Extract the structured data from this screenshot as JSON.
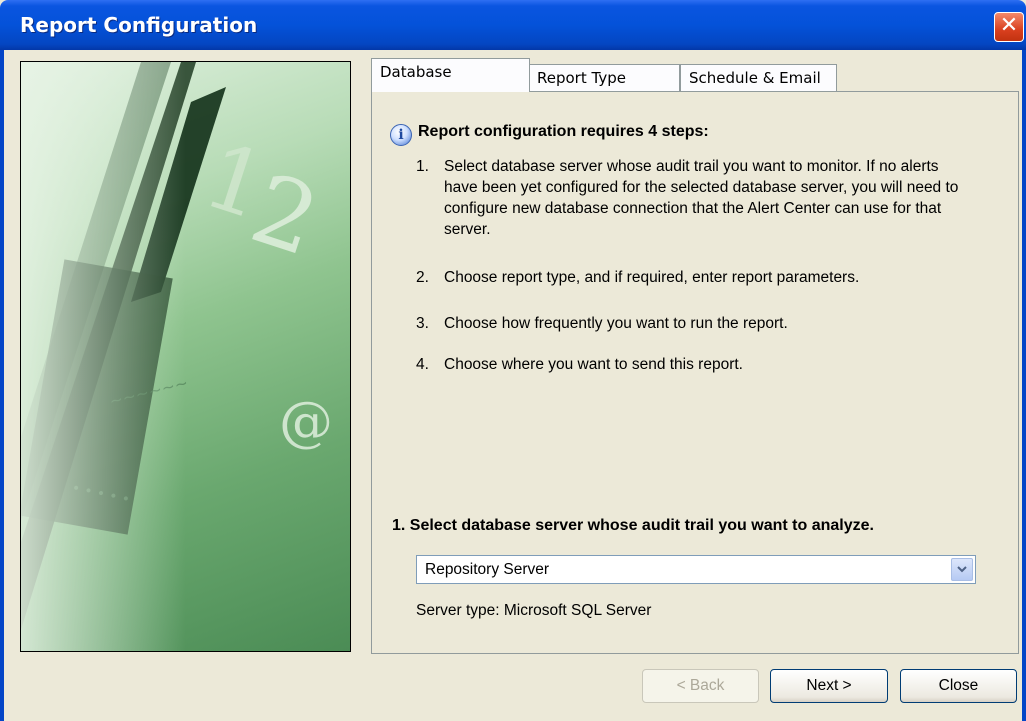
{
  "window": {
    "title": "Report Configuration",
    "close_glyph": "✕"
  },
  "tabs": [
    {
      "label": "Database",
      "active": true
    },
    {
      "label": "Report Type",
      "active": false
    },
    {
      "label": "Schedule & Email",
      "active": false
    }
  ],
  "content": {
    "info_icon_glyph": "i",
    "heading": "Report configuration requires 4 steps:",
    "steps": [
      {
        "num": "1.",
        "text": "Select database server whose audit trail you want to monitor. If no alerts have been yet configured for the selected database server, you will need to configure new database connection that the Alert Center can use for that server."
      },
      {
        "num": "2.",
        "text": "Choose report type, and if required, enter report parameters."
      },
      {
        "num": "3.",
        "text": "Choose how frequently you want to run the report."
      },
      {
        "num": "4.",
        "text": "Choose where you want to send this report."
      }
    ],
    "select_heading": "1. Select database server whose audit trail you want to analyze.",
    "server_select": {
      "value": "Repository Server"
    },
    "server_type": "Server type:  Microsoft SQL Server"
  },
  "buttons": {
    "back": "< Back",
    "next": "Next >",
    "close": "Close"
  },
  "colors": {
    "title_bar": "#0452d9",
    "close_button": "#d9401f",
    "dialog_bg": "#ece9d8",
    "image_green": "#8fc48f"
  }
}
